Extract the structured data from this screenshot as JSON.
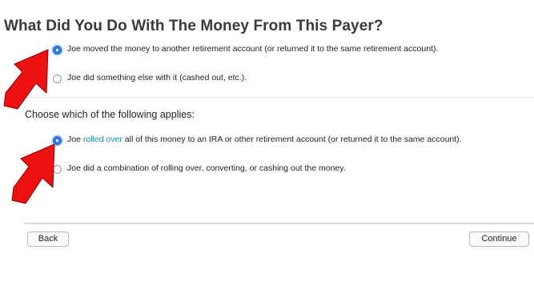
{
  "page": {
    "title": "What Did You Do With The Money From This Payer?"
  },
  "question1": {
    "options": [
      {
        "label": "Joe moved the money to another retirement account (or returned it to the same retirement account).",
        "selected": true
      },
      {
        "label": "Joe did something else with it (cashed out, etc.).",
        "selected": false
      }
    ]
  },
  "question2": {
    "heading": "Choose which of the following applies:",
    "option1": {
      "prefix": "Joe ",
      "link": "rolled over",
      "suffix": " all of this money to an IRA or other retirement account (or returned it to the same account).",
      "selected": true
    },
    "option2": {
      "label": "Joe did a combination of rolling over, converting, or cashing out the money.",
      "selected": false
    }
  },
  "footer": {
    "back_label": "Back",
    "continue_label": "Continue"
  },
  "colors": {
    "annotation_arrow": "#ee1111",
    "radio_selected": "#2f7fe5",
    "link": "#1a8ab3"
  },
  "icons": [
    "red-annotation-arrow-icon"
  ]
}
